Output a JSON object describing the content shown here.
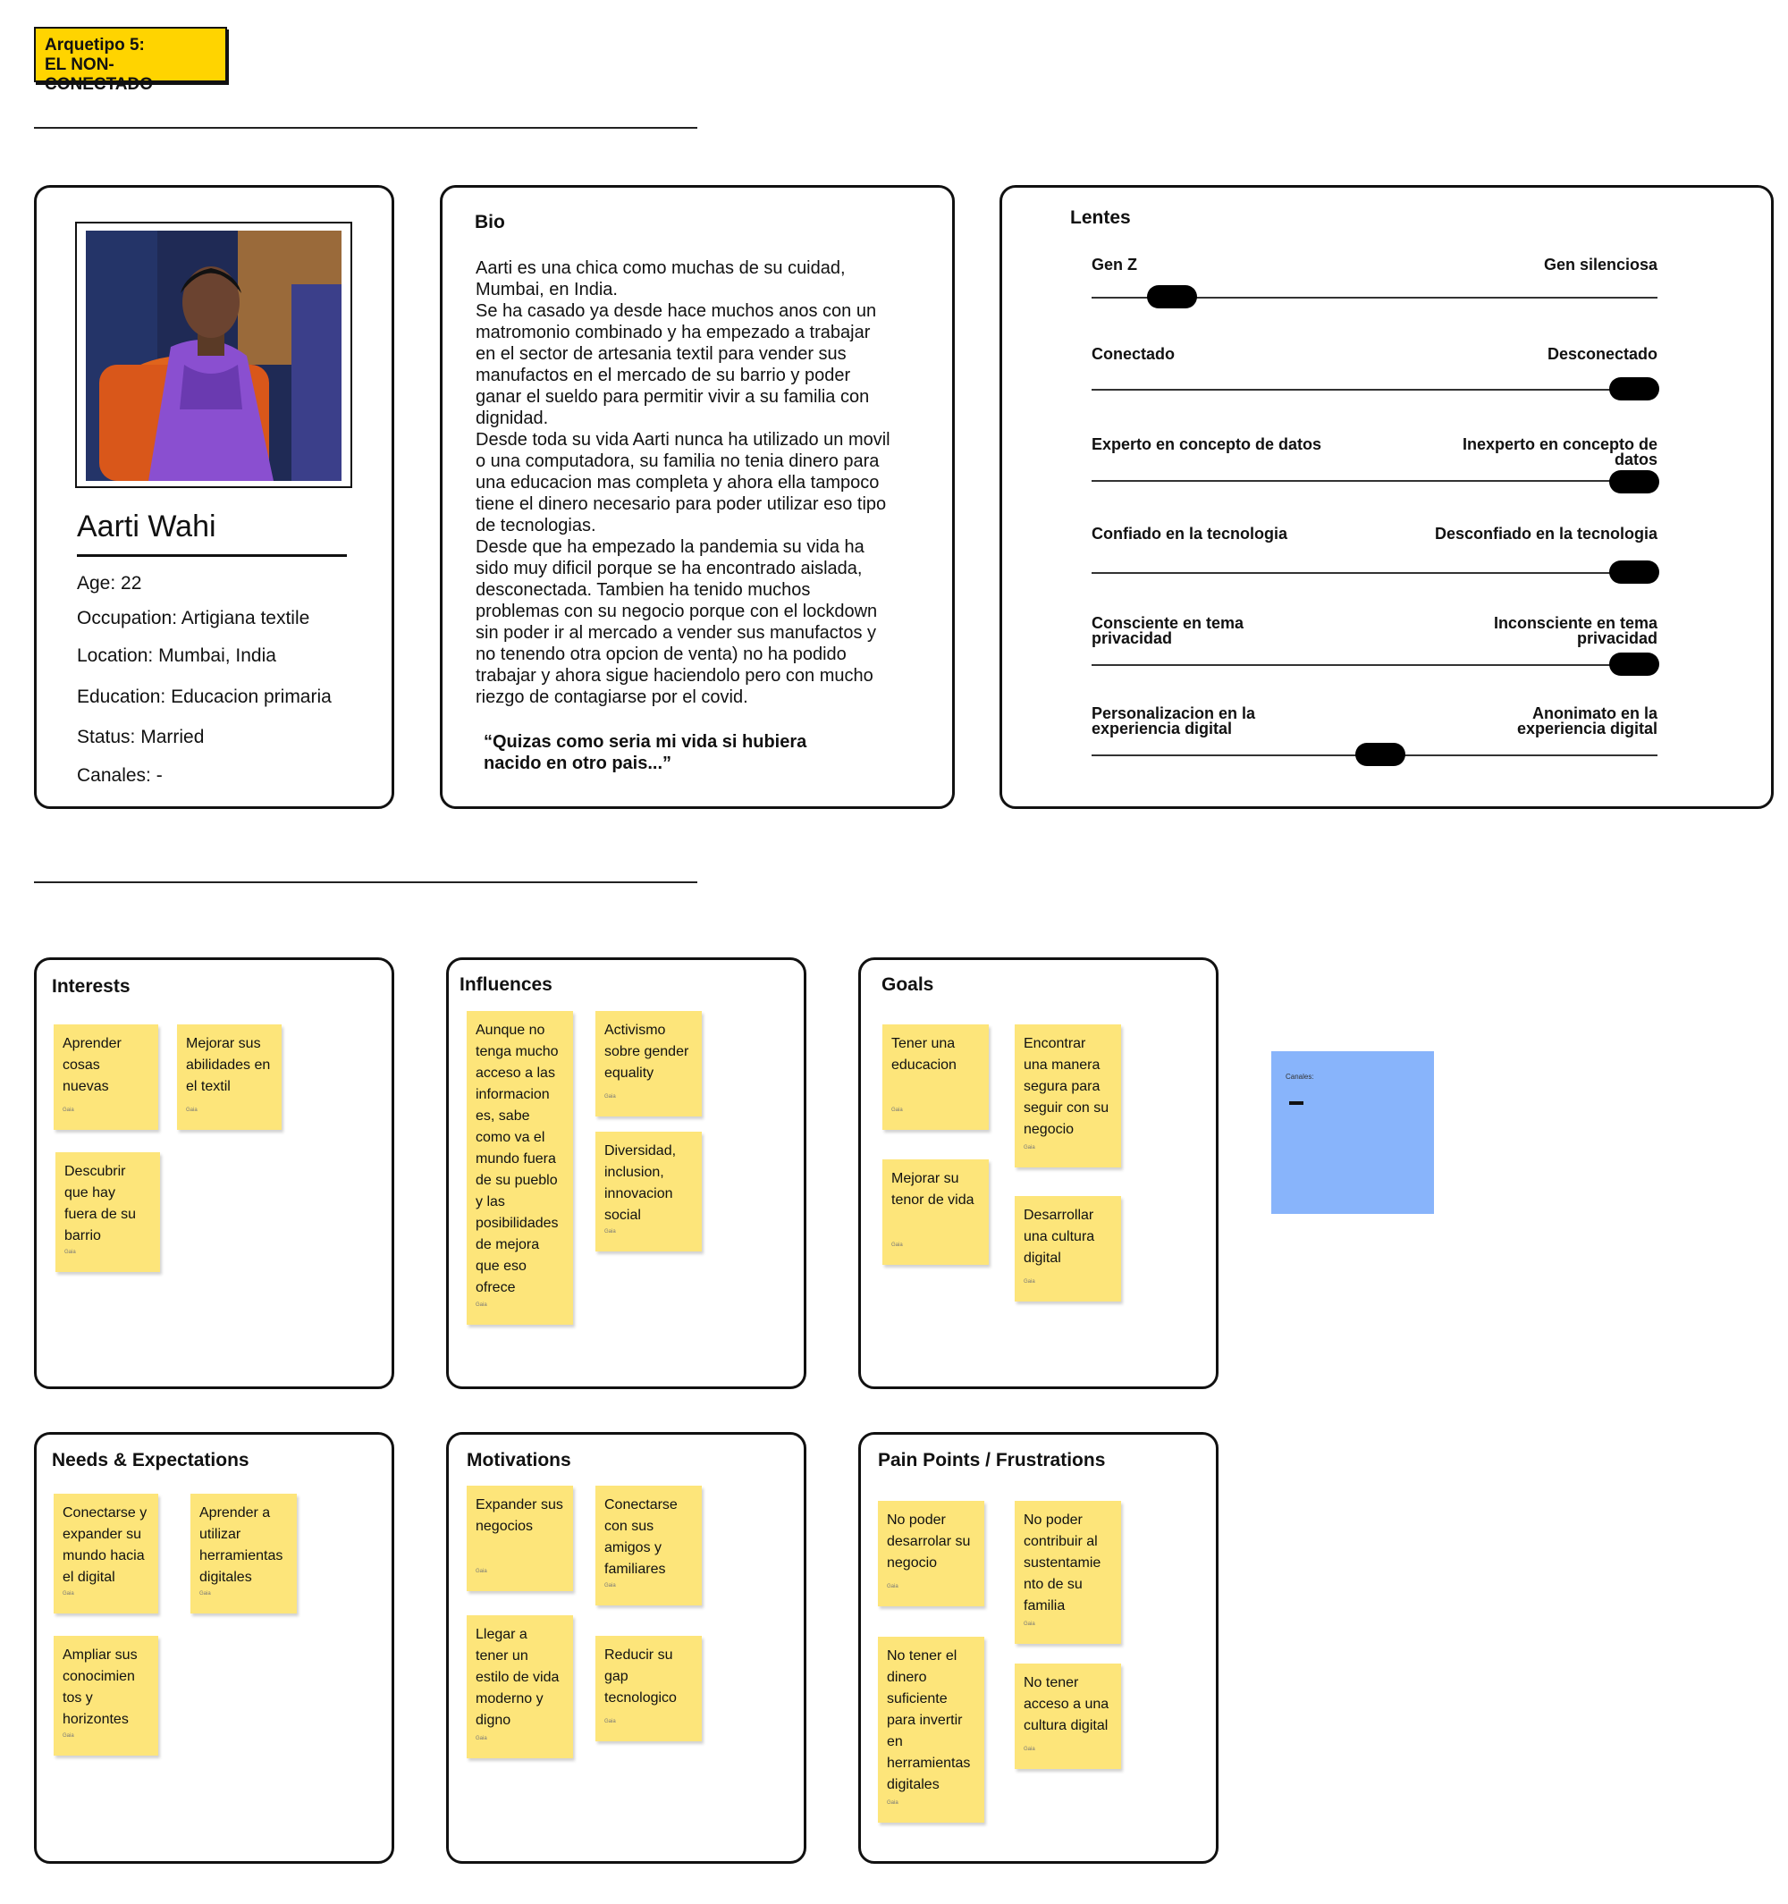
{
  "tag": {
    "line1": "Arquetipo 5:",
    "line2": "EL NON-CONECTADO"
  },
  "profile": {
    "name": "Aarti Wahi",
    "age": "Age: 22",
    "occupation": "Occupation: Artigiana textile",
    "location": "Location: Mumbai, India",
    "education": "Education: Educacion primaria",
    "status": "Status: Married",
    "canales": "Canales: -"
  },
  "bio": {
    "title": "Bio",
    "lines": [
      "Aarti es una chica como muchas de su cuidad,",
      "Mumbai, en India.",
      "Se ha casado ya desde hace muchos anos con un",
      "matromonio combinado y ha empezado a trabajar",
      "en el sector de artesania textil para vender sus",
      "manufactos en el mercado de su barrio y poder",
      "ganar el sueldo para permitir vivir a su familia con",
      "dignidad.",
      "Desde toda su vida Aarti nunca ha utilizado un movil",
      "o una computadora, su familia no tenia dinero para",
      "una educacion mas completa y ahora ella tampoco",
      "tiene el dinero necesario para poder utilizar eso tipo",
      "de tecnologias.",
      "Desde que ha empezado la pandemia su vida ha",
      "sido muy dificil porque se ha encontrado aislada,",
      "desconectada. Tambien ha tenido muchos",
      "problemas con su negocio porque con el lockdown",
      "sin poder ir al mercado a vender sus manufactos y",
      "no tenendo otra opcion de venta) no ha podido",
      "trabajar y ahora sigue haciendolo pero con mucho",
      "riezgo de contagiarse por el covid."
    ],
    "quote_line1": "“Quizas como seria mi vida si hubiera",
    "quote_line2": "nacido en otro pais...”"
  },
  "lentes": {
    "title": "Lentes",
    "scales": [
      {
        "left": "Gen Z",
        "right": "Gen silenciosa",
        "value": 0.14
      },
      {
        "left": "Conectado",
        "right": "Desconectado",
        "value": 0.96
      },
      {
        "left": "Experto en  concepto de datos",
        "right_l1": "Inexperto en  concepto de",
        "right_l2": "datos",
        "value": 0.96
      },
      {
        "left": "Confiado en la tecnologia",
        "right": "Desconfiado en la tecnologia",
        "value": 0.96
      },
      {
        "left_l1": "Consciente en tema",
        "left_l2": "privacidad",
        "right_l1": "Inconsciente en tema",
        "right_l2": "privacidad",
        "value": 0.96
      },
      {
        "left_l1": "Personalizacion en la",
        "left_l2": "experiencia digital",
        "right_l1": "Anonimato en la",
        "right_l2": "experiencia digital",
        "value": 0.51
      }
    ]
  },
  "sections": {
    "interests": {
      "title": "Interests",
      "notes": [
        [
          "Aprender",
          "cosas",
          "nuevas"
        ],
        [
          "Mejorar sus",
          "abilidades en",
          "el textil"
        ],
        [
          "Descubrir",
          "que hay",
          "fuera de su",
          "barrio"
        ]
      ]
    },
    "influences": {
      "title": "Influences",
      "notes": [
        [
          "Aunque no",
          "tenga mucho",
          "acceso a las",
          "informacion",
          "es, sabe",
          "como va el",
          "mundo fuera",
          "de su pueblo",
          "y las",
          "posibilidades",
          "de mejora",
          "que eso",
          "ofrece"
        ],
        [
          "Activismo",
          "sobre gender",
          "equality"
        ],
        [
          "Diversidad,",
          "inclusion,",
          "innovacion",
          "social"
        ]
      ]
    },
    "goals": {
      "title": "Goals",
      "notes": [
        [
          "Tener una",
          "educacion"
        ],
        [
          "Encontrar",
          "una manera",
          "segura para",
          "seguir con su",
          "negocio"
        ],
        [
          "Mejorar su",
          "tenor de vida"
        ],
        [
          "Desarrollar",
          "una cultura",
          "digital"
        ]
      ]
    },
    "needs": {
      "title": "Needs & Expectations",
      "notes": [
        [
          "Conectarse y",
          "expander su",
          "mundo hacia",
          "el digital"
        ],
        [
          "Aprender a",
          "utilizar",
          "herramientas",
          "digitales"
        ],
        [
          "Ampliar sus",
          "conocimien",
          "tos y",
          "horizontes"
        ]
      ]
    },
    "motivations": {
      "title": "Motivations",
      "notes": [
        [
          "Expander sus",
          "negocios"
        ],
        [
          "Conectarse",
          "con sus",
          "amigos y",
          "familiares"
        ],
        [
          "Llegar a",
          "tener un",
          "estilo de vida",
          "moderno y",
          "digno"
        ],
        [
          "Reducir su",
          "gap",
          "tecnologico"
        ]
      ]
    },
    "pain": {
      "title": "Pain Points / Frustrations",
      "notes": [
        [
          "No poder",
          "desarrolar su",
          "negocio"
        ],
        [
          "No poder",
          "contribuir al",
          "sustentamie",
          "nto de su",
          "familia"
        ],
        [
          "No tener el",
          "dinero",
          "suficiente",
          "para invertir",
          "en",
          "herramientas",
          "digitales"
        ],
        [
          "No tener",
          "acceso a una",
          "cultura digital"
        ]
      ]
    }
  },
  "sticky_author": "Gaia",
  "blue_note": {
    "label": "Canales:",
    "value": "-"
  },
  "colors": {
    "tag": "#FFD400",
    "sticky": "#FDE57A",
    "blue_note": "#88B4FB"
  }
}
